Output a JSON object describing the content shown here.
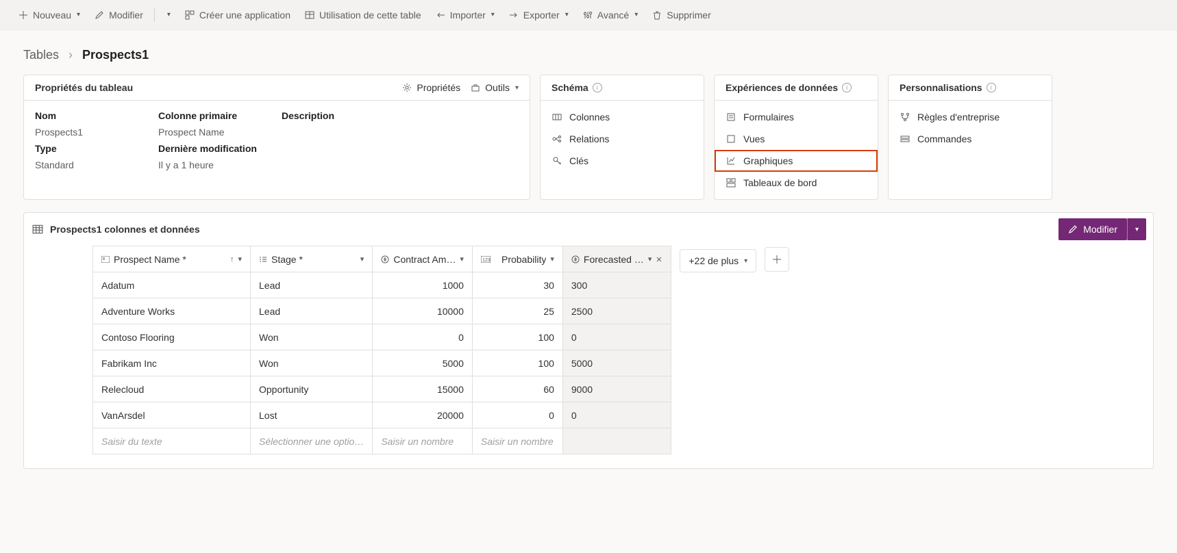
{
  "toolbar": {
    "nouveau": "Nouveau",
    "modifier": "Modifier",
    "creer_app": "Créer une application",
    "utilisation": "Utilisation de cette table",
    "importer": "Importer",
    "exporter": "Exporter",
    "avance": "Avancé",
    "supprimer": "Supprimer"
  },
  "breadcrumb": {
    "root": "Tables",
    "current": "Prospects1"
  },
  "props": {
    "title": "Propriétés du tableau",
    "action_props": "Propriétés",
    "action_outils": "Outils",
    "labels": {
      "nom": "Nom",
      "colonne_primaire": "Colonne primaire",
      "description": "Description",
      "type": "Type",
      "derniere_modif": "Dernière modification"
    },
    "values": {
      "nom": "Prospects1",
      "colonne_primaire": "Prospect Name",
      "description": "",
      "type": "Standard",
      "derniere_modif": "Il y a 1 heure"
    }
  },
  "schema": {
    "title": "Schéma",
    "items": [
      "Colonnes",
      "Relations",
      "Clés"
    ]
  },
  "experiences": {
    "title": "Expériences de données",
    "items": [
      "Formulaires",
      "Vues",
      "Graphiques",
      "Tableaux de bord"
    ]
  },
  "personnalisations": {
    "title": "Personnalisations",
    "items": [
      "Règles d'entreprise",
      "Commandes"
    ]
  },
  "data_section": {
    "title": "Prospects1 colonnes et données",
    "modifier": "Modifier",
    "more_cols": "+22 de plus",
    "headers": {
      "name": "Prospect Name",
      "stage": "Stage",
      "contract": "Contract Am…",
      "prob": "Probability",
      "forecast": "Forecasted …"
    },
    "rows": [
      {
        "name": "Adatum",
        "stage": "Lead",
        "contract": "1000",
        "prob": "30",
        "forecast": "300"
      },
      {
        "name": "Adventure Works",
        "stage": "Lead",
        "contract": "10000",
        "prob": "25",
        "forecast": "2500"
      },
      {
        "name": "Contoso Flooring",
        "stage": "Won",
        "contract": "0",
        "prob": "100",
        "forecast": "0"
      },
      {
        "name": "Fabrikam Inc",
        "stage": "Won",
        "contract": "5000",
        "prob": "100",
        "forecast": "5000"
      },
      {
        "name": "Relecloud",
        "stage": "Opportunity",
        "contract": "15000",
        "prob": "60",
        "forecast": "9000"
      },
      {
        "name": "VanArsdel",
        "stage": "Lost",
        "contract": "20000",
        "prob": "0",
        "forecast": "0"
      }
    ],
    "placeholders": {
      "name": "Saisir du texte",
      "stage": "Sélectionner une optio…",
      "contract": "Saisir un nombre",
      "prob": "Saisir un nombre",
      "forecast": ""
    }
  }
}
